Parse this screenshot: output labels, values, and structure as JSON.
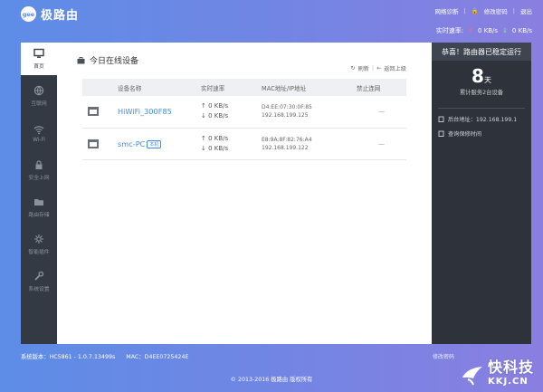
{
  "header": {
    "logo_badge": "gee",
    "logo_text": "极路由",
    "nav": [
      "网络诊断",
      "修改密码",
      "退出"
    ],
    "speed_label": "实时速率:",
    "upload_speed": "0 KB/s",
    "download_speed": "0 KB/s"
  },
  "sidebar": {
    "items": [
      {
        "label": "首页",
        "icon": "monitor-icon"
      },
      {
        "label": "互联网",
        "icon": "globe-icon"
      },
      {
        "label": "Wi-Fi",
        "icon": "wifi-icon"
      },
      {
        "label": "安全上网",
        "icon": "lock-icon"
      },
      {
        "label": "路由存储",
        "icon": "folder-icon"
      },
      {
        "label": "智能插件",
        "icon": "gear-icon"
      },
      {
        "label": "系统设置",
        "icon": "wrench-icon"
      }
    ]
  },
  "main": {
    "title": "今日在线设备",
    "refresh": "刷新",
    "back": "返回上级",
    "columns": [
      "设备名称",
      "实时速率",
      "MAC地址/IP地址",
      "禁止连网"
    ],
    "devices": [
      {
        "name": "HiWiFi_300F85",
        "badge": "",
        "up": "0 KB/s",
        "down": "0 KB/s",
        "mac": "D4:EE:07:30:0F:85",
        "ip": "192.168.199.125",
        "block": "—"
      },
      {
        "name": "smc-PC",
        "badge": "本机",
        "up": "0 KB/s",
        "down": "0 KB/s",
        "mac": "E8:9A:8F:82:76:A4",
        "ip": "192.168.199.122",
        "block": "—"
      }
    ]
  },
  "status": {
    "heading": "恭喜！路由器已稳定运行",
    "uptime_value": "8",
    "uptime_unit": "天",
    "serve_text": "累计服务2台设备",
    "admin_label": "后台地址：192.168.199.1",
    "warranty_label": "查询保修时间"
  },
  "footer": {
    "version": "系统版本：HC5861 - 1.0.7.13499s",
    "mac": "MAC：D4EE0725424E",
    "link": "修改密码",
    "copyright": "© 2013-2016 极路由 版权所有"
  },
  "watermark": {
    "main": "快科技",
    "sub": "KKJ.CN"
  }
}
